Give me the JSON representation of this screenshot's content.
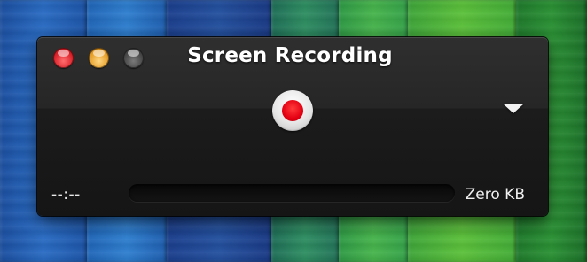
{
  "window": {
    "title": "Screen Recording"
  },
  "controls": {
    "close_icon": "close-icon",
    "minimize_icon": "minimize-icon",
    "zoom_icon": "zoom-icon",
    "record_icon": "record-icon",
    "options_icon": "triangle-down-icon"
  },
  "status": {
    "elapsed_time": "--:--",
    "file_size": "Zero KB",
    "progress": 0
  },
  "colors": {
    "record_red": "#e40012",
    "hud_background": "#1c1c1c",
    "close_red": "#d81f27",
    "minimize_yellow": "#e49a22"
  }
}
